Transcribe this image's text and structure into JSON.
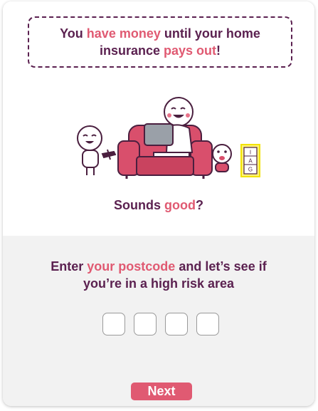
{
  "banner": {
    "part1": "You ",
    "highlight1": "have money",
    "part2": " until your home insurance ",
    "highlight2": "pays out",
    "part3": "!"
  },
  "question": {
    "part1": "Sounds ",
    "highlight": "good",
    "part2": "?"
  },
  "prompt": {
    "part1": "Enter ",
    "highlight": "your postcode",
    "part2": " and let’s see if you’re in a high risk area"
  },
  "postcode": {
    "digit_count": 4
  },
  "next_button": {
    "label": "Next"
  },
  "sign": {
    "letters": [
      "I",
      "A",
      "G"
    ]
  },
  "colors": {
    "brand_purple": "#5b2150",
    "accent_pink": "#e05a72",
    "sofa": "#d94f6c",
    "bottom_panel": "#f2f2f2"
  }
}
